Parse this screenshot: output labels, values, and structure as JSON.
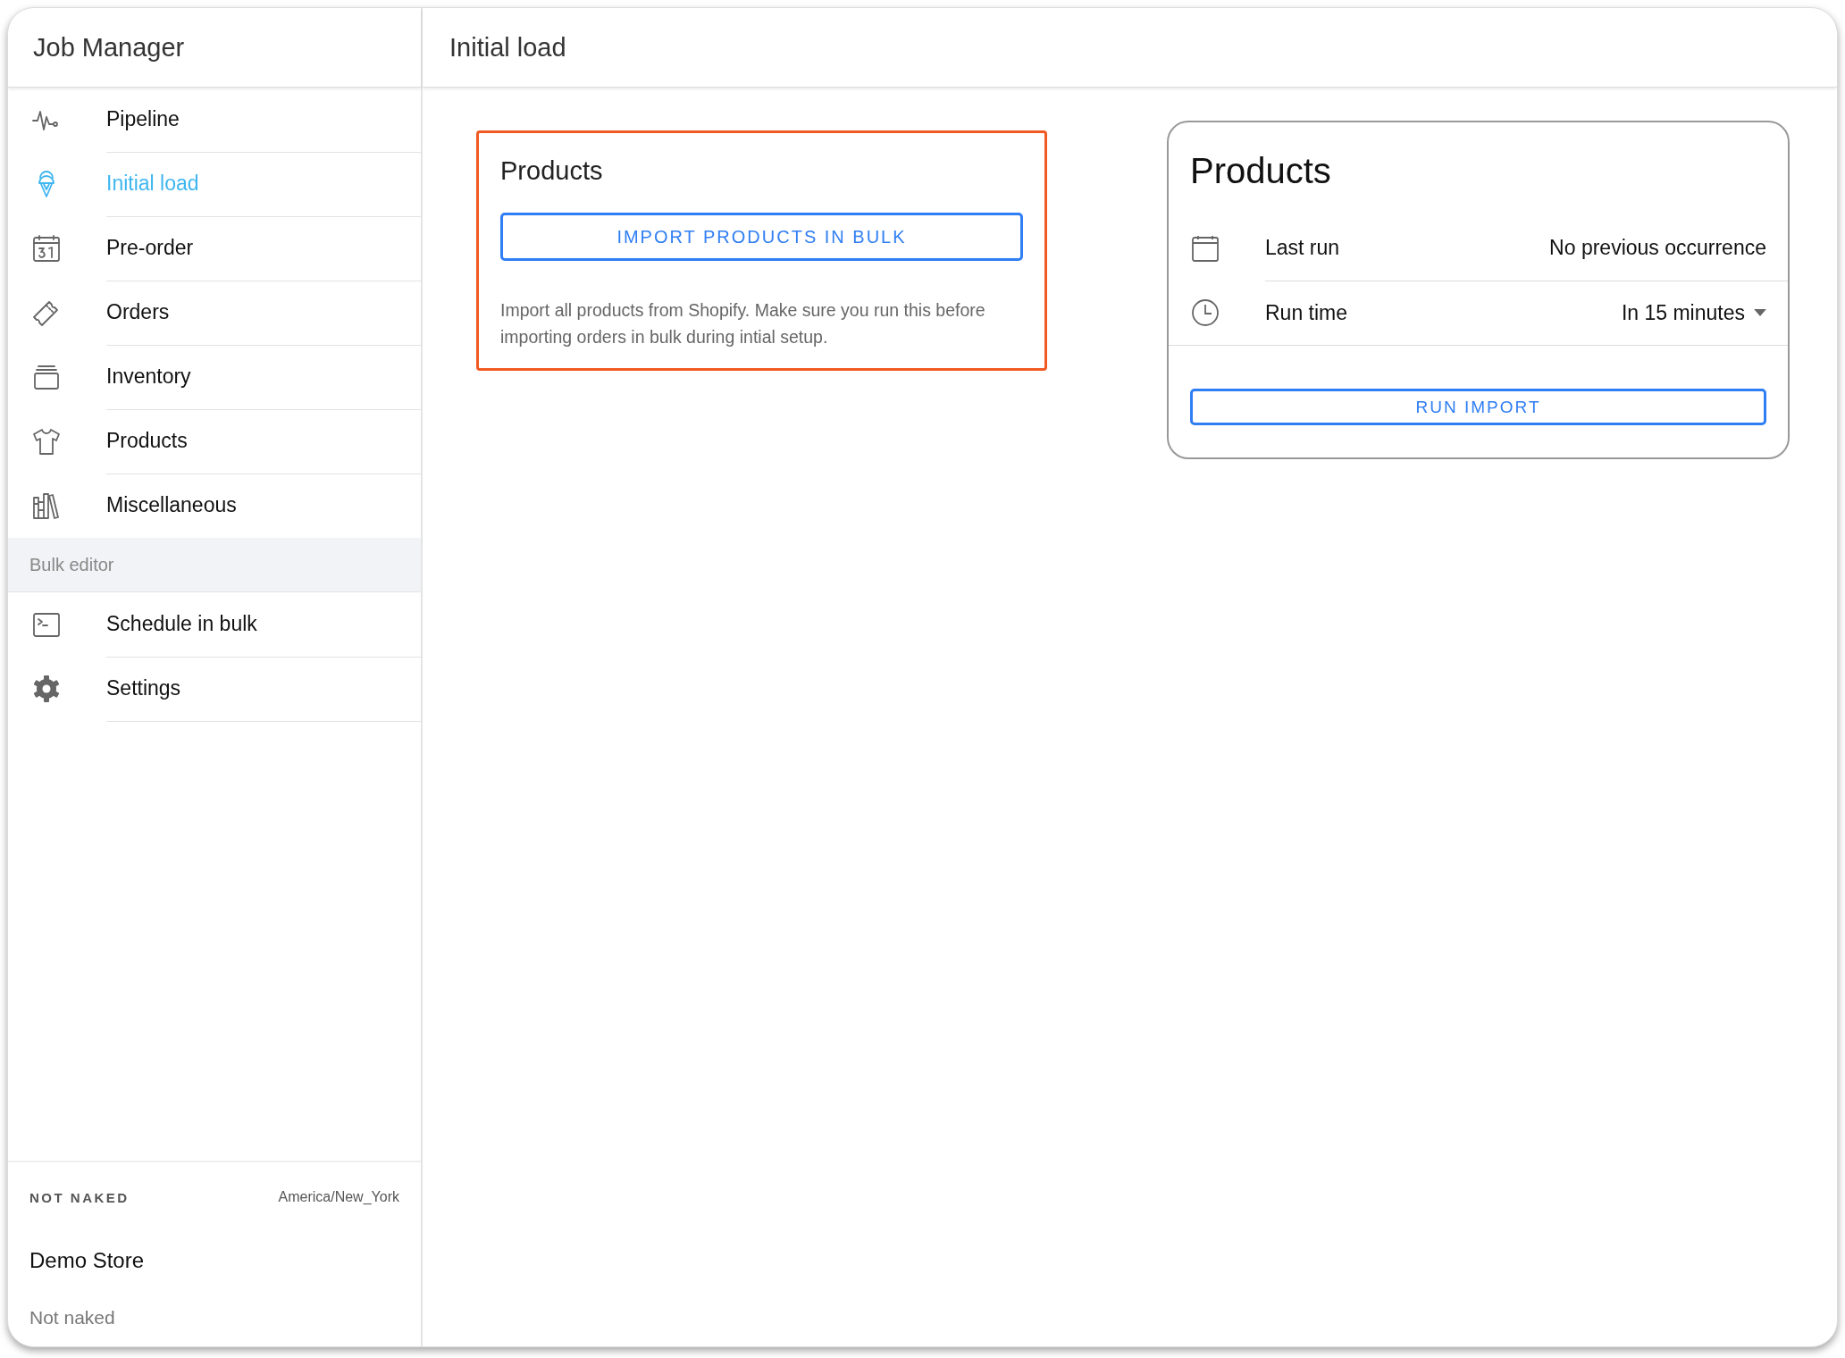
{
  "sidebar": {
    "title": "Job Manager",
    "items": [
      {
        "label": "Pipeline",
        "selected": false
      },
      {
        "label": "Initial load",
        "selected": true
      },
      {
        "label": "Pre-order",
        "selected": false
      },
      {
        "label": "Orders",
        "selected": false
      },
      {
        "label": "Inventory",
        "selected": false
      },
      {
        "label": "Products",
        "selected": false
      },
      {
        "label": "Miscellaneous",
        "selected": false
      }
    ],
    "section": {
      "label": "Bulk editor",
      "items": [
        {
          "label": "Schedule in bulk",
          "selected": false
        },
        {
          "label": "Settings",
          "selected": false
        }
      ]
    },
    "footer": {
      "store_label": "NOT NAKED",
      "timezone": "America/New_York",
      "store_name": "Demo Store",
      "store_subtitle": "Not naked"
    }
  },
  "header": {
    "title": "Initial load"
  },
  "import_card": {
    "title": "Products",
    "button": "IMPORT PRODUCTS IN BULK",
    "description": "Import all products from Shopify. Make sure you run this before importing orders in bulk during intial setup."
  },
  "schedule_card": {
    "title": "Products",
    "rows": [
      {
        "label": "Last run",
        "value": "No previous occurrence",
        "kind": "text"
      },
      {
        "label": "Run time",
        "value": "In 15 minutes",
        "kind": "dropdown"
      }
    ],
    "button": "RUN IMPORT"
  }
}
